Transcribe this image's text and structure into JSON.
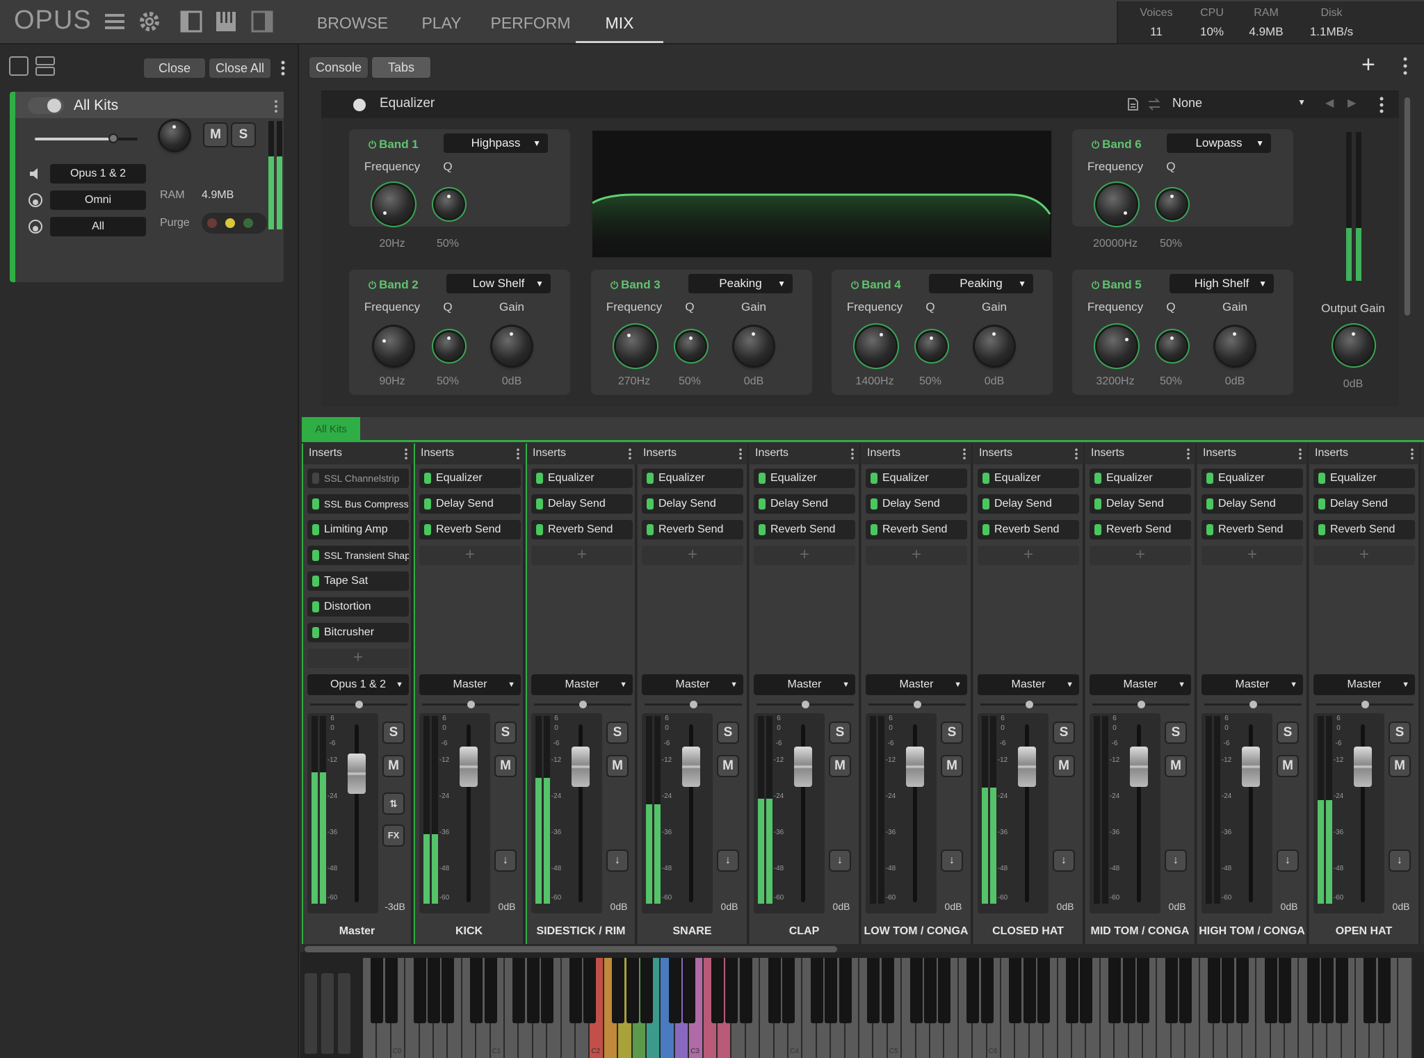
{
  "app": {
    "brand": "OPUS"
  },
  "nav": {
    "tabs": [
      "BROWSE",
      "PLAY",
      "PERFORM",
      "MIX"
    ],
    "active": "MIX"
  },
  "stats": [
    {
      "label": "Voices",
      "value": "11"
    },
    {
      "label": "CPU",
      "value": "10%"
    },
    {
      "label": "RAM",
      "value": "4.9MB"
    },
    {
      "label": "Disk",
      "value": "1.1MB/s"
    }
  ],
  "left": {
    "close_label": "Close",
    "close_all_label": "Close All",
    "kit": {
      "name": "All Kits",
      "mute": "M",
      "solo": "S",
      "output": "Opus 1 & 2",
      "midi_in": "Omni",
      "channel": "All",
      "ram_label": "RAM",
      "ram_value": "4.9MB",
      "purge_label": "Purge"
    }
  },
  "right": {
    "console_label": "Console",
    "tabs_label": "Tabs",
    "add_label": "+"
  },
  "eq": {
    "title": "Equalizer",
    "preset": "None",
    "bands": [
      {
        "name": "Band 1",
        "type": "Highpass",
        "labels": [
          "Frequency",
          "Q"
        ],
        "values": [
          "20Hz",
          "50%"
        ]
      },
      {
        "name": "Band 6",
        "type": "Lowpass",
        "labels": [
          "Frequency",
          "Q"
        ],
        "values": [
          "20000Hz",
          "50%"
        ]
      },
      {
        "name": "Band 2",
        "type": "Low Shelf",
        "labels": [
          "Frequency",
          "Q",
          "Gain"
        ],
        "values": [
          "90Hz",
          "50%",
          "0dB"
        ]
      },
      {
        "name": "Band 3",
        "type": "Peaking",
        "labels": [
          "Frequency",
          "Q",
          "Gain"
        ],
        "values": [
          "270Hz",
          "50%",
          "0dB"
        ]
      },
      {
        "name": "Band 4",
        "type": "Peaking",
        "labels": [
          "Frequency",
          "Q",
          "Gain"
        ],
        "values": [
          "1400Hz",
          "50%",
          "0dB"
        ]
      },
      {
        "name": "Band 5",
        "type": "High Shelf",
        "labels": [
          "Frequency",
          "Q",
          "Gain"
        ],
        "values": [
          "3200Hz",
          "50%",
          "0dB"
        ]
      }
    ],
    "output_gain": {
      "label": "Output Gain",
      "value": "0dB"
    }
  },
  "mixer": {
    "tab": "All Kits",
    "inserts_label": "Inserts",
    "add_slot": "+",
    "scale": [
      "6",
      "0",
      "-6",
      "-12",
      "-24",
      "-36",
      "-48",
      "-60"
    ],
    "solo": "S",
    "mute": "M",
    "strips": [
      {
        "name": "Master",
        "output": "Opus 1 & 2",
        "db": "-3dB",
        "meter": 0.7,
        "inserts": [
          {
            "label": "SSL Channelstrip",
            "on": false
          },
          {
            "label": "SSL Bus Compressor",
            "on": true
          },
          {
            "label": "Limiting Amp",
            "on": true
          },
          {
            "label": "SSL Transient Shaper",
            "on": true
          },
          {
            "label": "Tape Sat",
            "on": true
          },
          {
            "label": "Distortion",
            "on": true
          },
          {
            "label": "Bitcrusher",
            "on": true
          }
        ]
      },
      {
        "name": "KICK",
        "output": "Master",
        "db": "0dB",
        "meter": 0.37,
        "inserts": [
          {
            "label": "Equalizer",
            "on": true
          },
          {
            "label": "Delay Send",
            "on": true
          },
          {
            "label": "Reverb Send",
            "on": true
          }
        ]
      },
      {
        "name": "SIDESTICK / RIM",
        "output": "Master",
        "db": "0dB",
        "meter": 0.67,
        "inserts": [
          {
            "label": "Equalizer",
            "on": true
          },
          {
            "label": "Delay Send",
            "on": true
          },
          {
            "label": "Reverb Send",
            "on": true
          }
        ]
      },
      {
        "name": "SNARE",
        "output": "Master",
        "db": "0dB",
        "meter": 0.53,
        "inserts": [
          {
            "label": "Equalizer",
            "on": true
          },
          {
            "label": "Delay Send",
            "on": true
          },
          {
            "label": "Reverb Send",
            "on": true
          }
        ]
      },
      {
        "name": "CLAP",
        "output": "Master",
        "db": "0dB",
        "meter": 0.56,
        "inserts": [
          {
            "label": "Equalizer",
            "on": true
          },
          {
            "label": "Delay Send",
            "on": true
          },
          {
            "label": "Reverb Send",
            "on": true
          }
        ]
      },
      {
        "name": "LOW TOM / CONGA",
        "output": "Master",
        "db": "0dB",
        "meter": 0.0,
        "inserts": [
          {
            "label": "Equalizer",
            "on": true
          },
          {
            "label": "Delay Send",
            "on": true
          },
          {
            "label": "Reverb Send",
            "on": true
          }
        ]
      },
      {
        "name": "CLOSED HAT",
        "output": "Master",
        "db": "0dB",
        "meter": 0.62,
        "inserts": [
          {
            "label": "Equalizer",
            "on": true
          },
          {
            "label": "Delay Send",
            "on": true
          },
          {
            "label": "Reverb Send",
            "on": true
          }
        ]
      },
      {
        "name": "MID TOM / CONGA",
        "output": "Master",
        "db": "0dB",
        "meter": 0.0,
        "inserts": [
          {
            "label": "Equalizer",
            "on": true
          },
          {
            "label": "Delay Send",
            "on": true
          },
          {
            "label": "Reverb Send",
            "on": true
          }
        ]
      },
      {
        "name": "HIGH TOM / CONGA",
        "output": "Master",
        "db": "0dB",
        "meter": 0.0,
        "inserts": [
          {
            "label": "Equalizer",
            "on": true
          },
          {
            "label": "Delay Send",
            "on": true
          },
          {
            "label": "Reverb Send",
            "on": true
          }
        ]
      },
      {
        "name": "OPEN HAT",
        "output": "Master",
        "db": "0dB",
        "meter": 0.55,
        "inserts": [
          {
            "label": "Equalizer",
            "on": true
          },
          {
            "label": "Delay Send",
            "on": true
          },
          {
            "label": "Reverb Send",
            "on": true
          }
        ]
      }
    ]
  },
  "keyboard": {
    "octave_labels": [
      "C0",
      "C1",
      "C2",
      "C3",
      "C4",
      "C5",
      "C6"
    ]
  },
  "colors": {
    "accent": "#4ac75e",
    "pad_colors": [
      "#c25048",
      "#c08a3a",
      "#a8a23a",
      "#5a9a4a",
      "#3c9a8a",
      "#4a7ac0",
      "#8a68c0",
      "#b06aa8",
      "#b85a78"
    ]
  }
}
